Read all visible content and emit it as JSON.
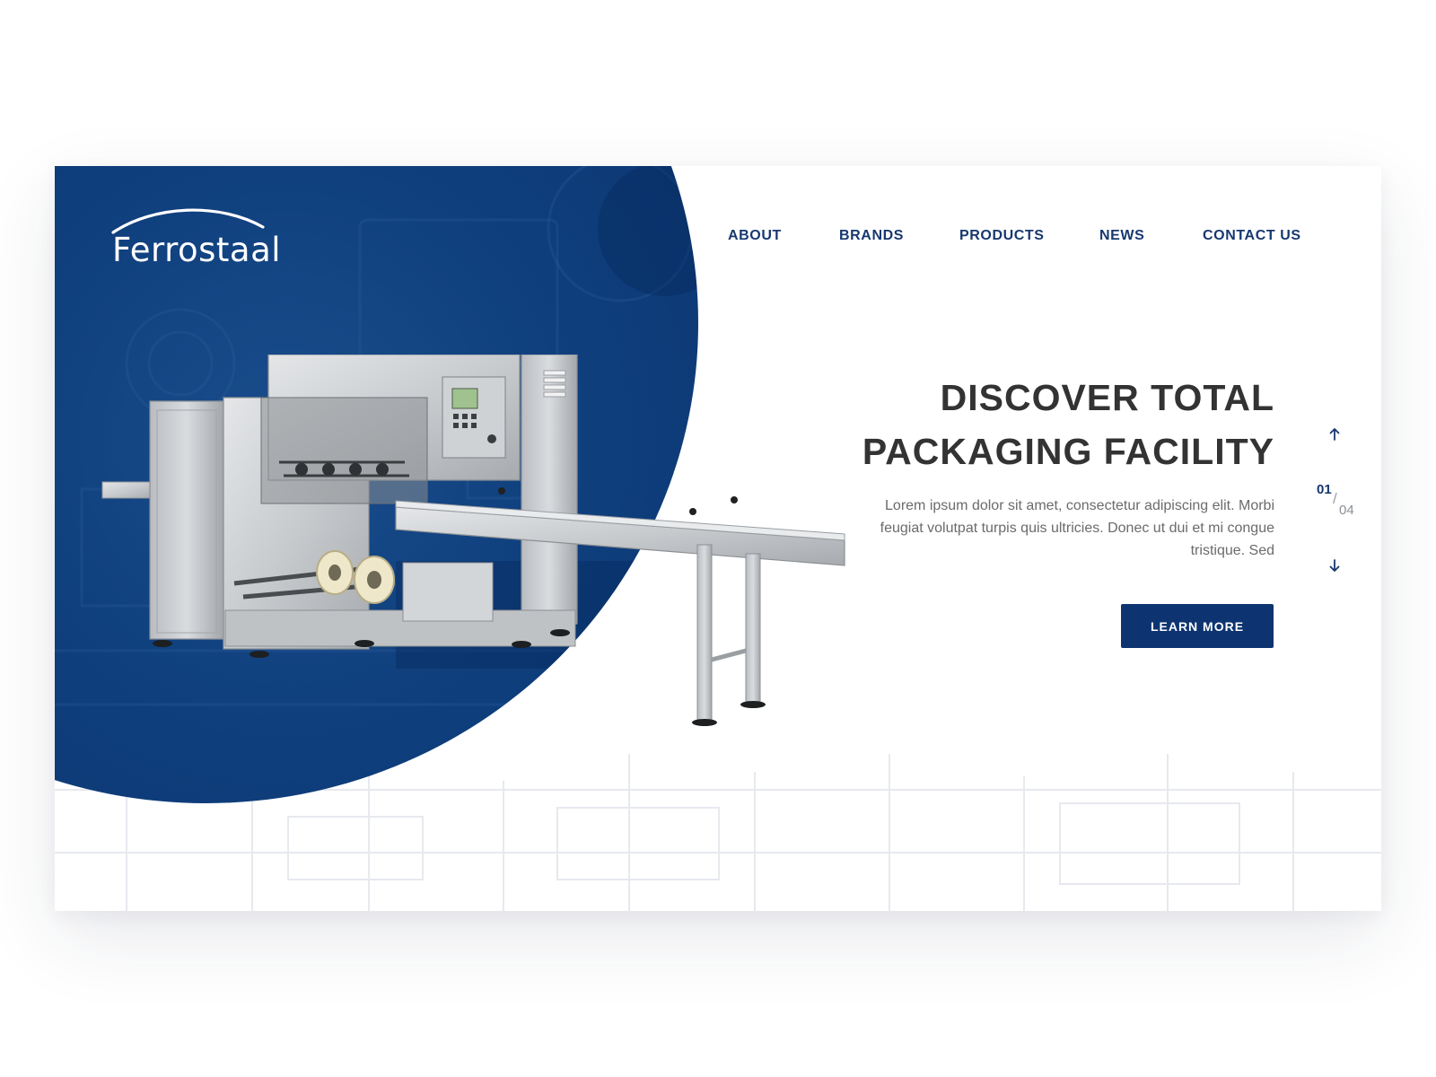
{
  "brand": {
    "name": "Ferrostaal",
    "primary_color": "#0d3470",
    "accent_nav_color": "#17386f"
  },
  "nav": {
    "items": [
      {
        "label": "ABOUT"
      },
      {
        "label": "BRANDS"
      },
      {
        "label": "PRODUCTS"
      },
      {
        "label": "NEWS"
      },
      {
        "label": "CONTACT US"
      }
    ]
  },
  "hero": {
    "title_line1": "DISCOVER TOTAL",
    "title_line2": "PACKAGING FACILITY",
    "description": "Lorem ipsum dolor sit amet, consectetur adipiscing elit. Morbi feugiat volutpat turpis quis ultricies. Donec ut dui et mi congue tristique. Sed",
    "cta_label": "LEARN MORE",
    "image": "packaging-machine"
  },
  "slider": {
    "current": "01",
    "separator": "/",
    "total": "04",
    "up_icon": "arrow-up-icon",
    "down_icon": "arrow-down-icon"
  }
}
